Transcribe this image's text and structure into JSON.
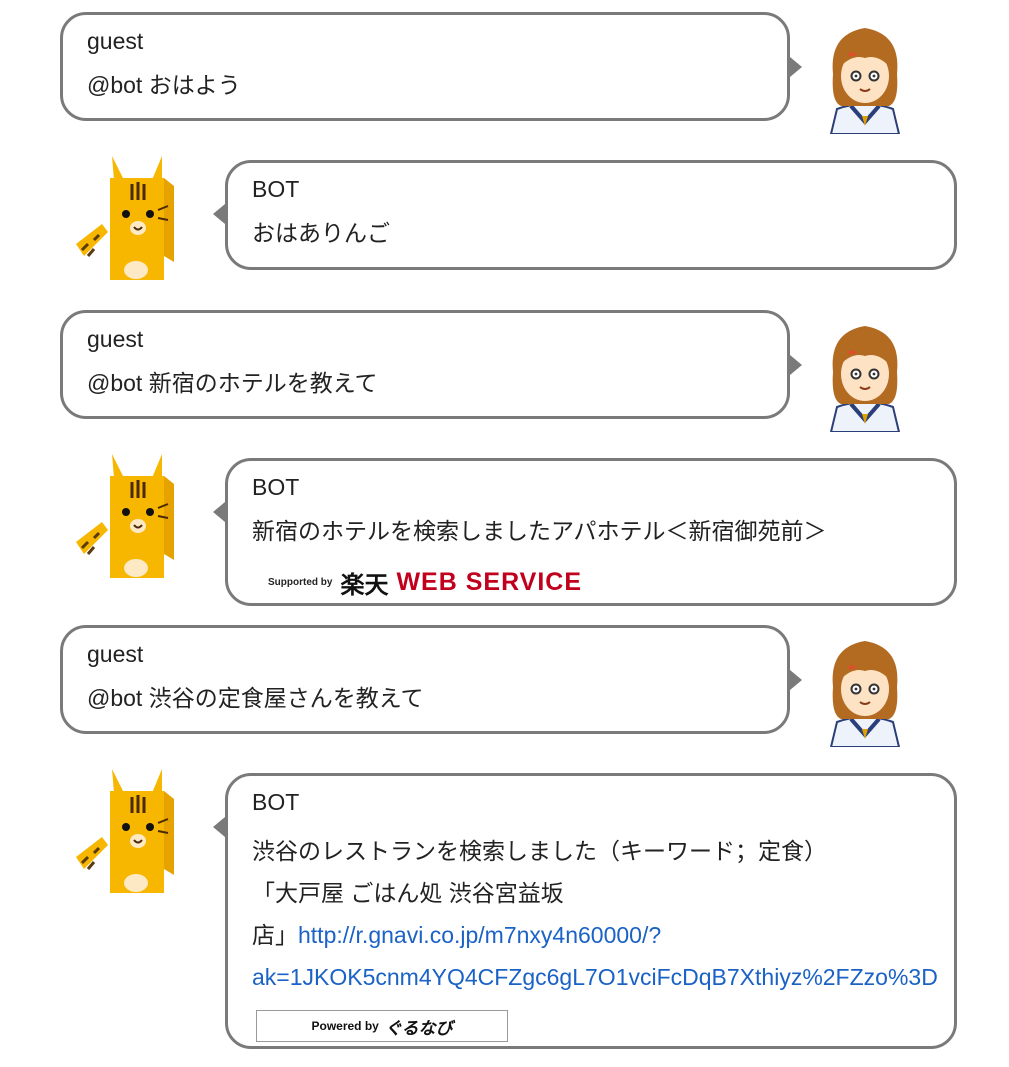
{
  "messages": [
    {
      "sender": "guest",
      "text": "@bot おはよう"
    },
    {
      "sender": "BOT",
      "text": "おはありんご"
    },
    {
      "sender": "guest",
      "text": "@bot 新宿のホテルを教えて"
    },
    {
      "sender": "BOT",
      "text": "新宿のホテルを検索しましたアパホテル＜新宿御苑前＞",
      "credit": {
        "supported_by": "Supported by",
        "brand": "楽天",
        "service": "WEB SERVICE"
      }
    },
    {
      "sender": "guest",
      "text": "@bot 渋谷の定食屋さんを教えて"
    },
    {
      "sender": "BOT",
      "line1": "渋谷のレストランを検索しました（キーワード；定食）",
      "line2": "「大戸屋 ごはん処 渋谷宮益坂",
      "line3_prefix": "店」",
      "link_part1": "http://r.gnavi.co.jp/m7nxy4n60000/?",
      "link_part2": "ak=1JKOK5cnm4YQ4CFZgc6gL7O1vciFcDqB7Xthiyz%2FZzo%3D",
      "credit": {
        "powered_by": "Powered by",
        "brand": "ぐるなび"
      }
    }
  ],
  "colors": {
    "bubble_border": "#7a7a7a",
    "link": "#1a62c6",
    "rakuten_red": "#c0001c",
    "cat_orange": "#f7b600"
  }
}
